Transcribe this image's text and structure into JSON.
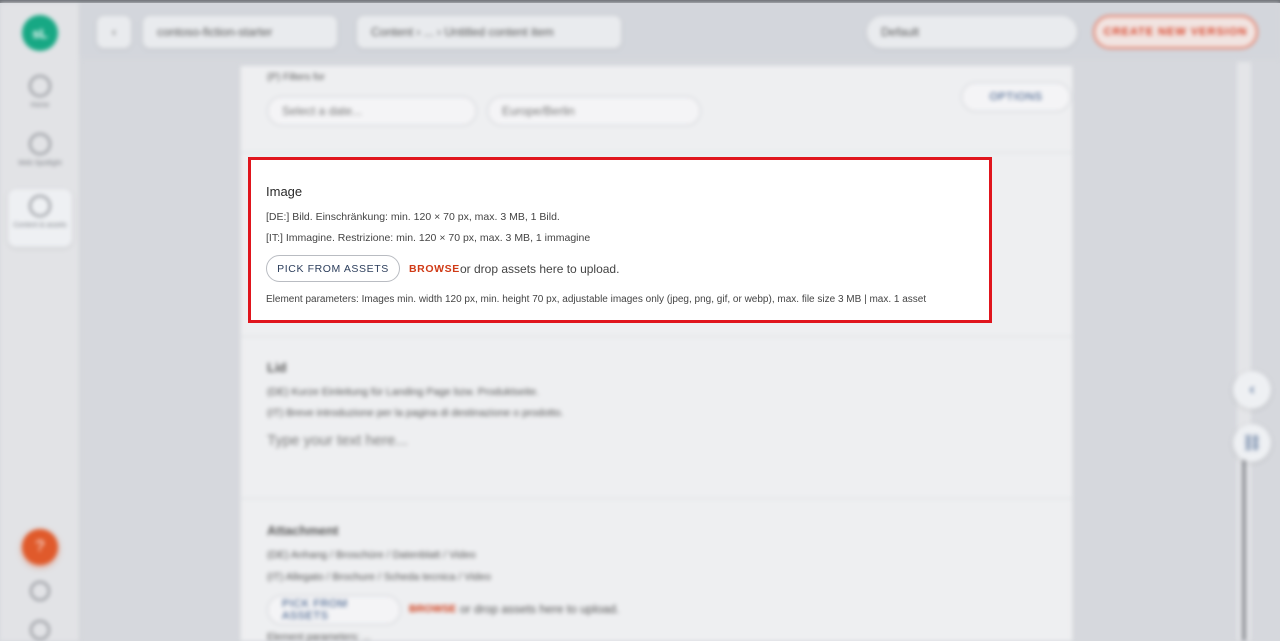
{
  "sidebar": {
    "logo": "sL",
    "items": [
      {
        "label": "Home"
      },
      {
        "label": "Web Spotlight"
      },
      {
        "label": "Content & assets"
      }
    ]
  },
  "topbar": {
    "project": "contoso-fiction-starter",
    "breadcrumb": "Content › ... › Untitled content item",
    "environment": "Default",
    "action": "CREATE NEW VERSION"
  },
  "blurred": {
    "filter_label": "(P) Filters for",
    "select_placeholder": "Select a date...",
    "select_option": "Europe/Berlin",
    "options_btn": "OPTIONS",
    "richtext_title": "Lid",
    "richtext_de": "(DE) Kurze Einleitung für Landing Page bzw. Produktseite.",
    "richtext_it": "(IT) Breve introduzione per la pagina di destinazione o prodotto.",
    "richtext_placeholder": "Type your text here...",
    "attachment_title": "Attachment",
    "attachment_de": "(DE) Anhang / Broschüre / Datenblatt / Video",
    "attachment_it": "(IT) Allegato / Brochure / Scheda tecnica / Video",
    "pick_btn": "PICK FROM ASSETS",
    "browse": "BROWSE",
    "drop": "or drop assets here to upload.",
    "params": "Element parameters: ..."
  },
  "image_element": {
    "title": "Image",
    "line_de": "[DE:] Bild. Einschränkung: min. 120 × 70 px, max. 3 MB, 1 Bild.",
    "line_it": "[IT:] Immagine. Restrizione: min. 120 × 70 px, max. 3 MB, 1 immagine",
    "pick_button": "PICK FROM ASSETS",
    "browse": "BROWSE",
    "drop_text": "or drop assets here to upload.",
    "parameters": "Element parameters: Images min. width 120 px, min. height 70 px, adjustable images only (jpeg, png, gif, or webp), max. file size 3 MB | max. 1 asset",
    "highlight_color": "#e0151d"
  }
}
